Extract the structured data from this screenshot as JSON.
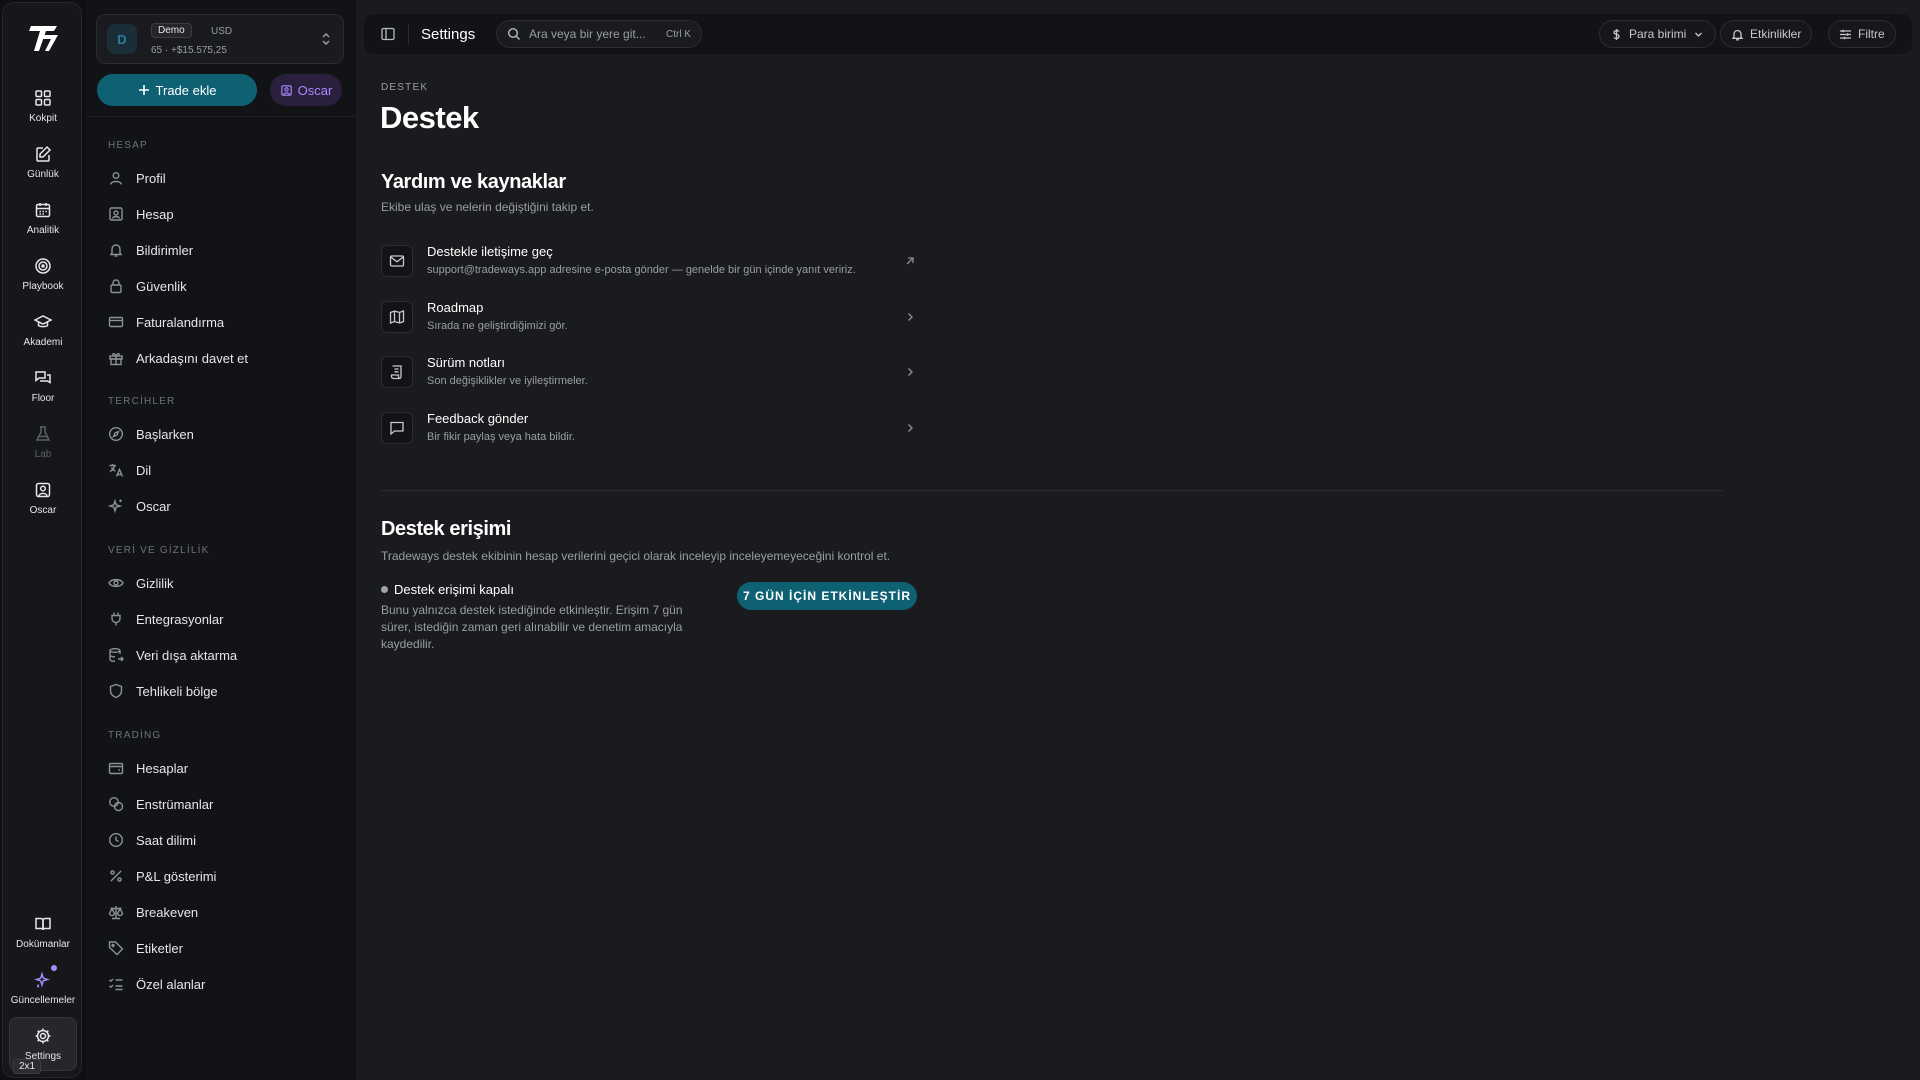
{
  "rail": {
    "items": [
      {
        "label": "Kokpit",
        "icon": "dashboard-icon"
      },
      {
        "label": "Günlük",
        "icon": "journal-icon"
      },
      {
        "label": "Analitik",
        "icon": "calendar-icon"
      },
      {
        "label": "Playbook",
        "icon": "target-icon"
      },
      {
        "label": "Akademi",
        "icon": "graduation-cap-icon"
      },
      {
        "label": "Floor",
        "icon": "chat-bubbles-icon"
      },
      {
        "label": "Lab",
        "icon": "flask-icon"
      },
      {
        "label": "Oscar",
        "icon": "oscar-portrait-icon"
      }
    ],
    "bottom": {
      "docs": "Dokümanlar",
      "updates": "Güncellemeler",
      "settings": "Settings",
      "shortcut_badge": "2x1"
    }
  },
  "account": {
    "initial": "D",
    "tag": "Demo",
    "currency": "USD",
    "balance": "65 · +$15.575,25"
  },
  "actions": {
    "add_trade": "Trade ekle",
    "oscar": "Oscar"
  },
  "sidebar": {
    "sections": [
      {
        "title": "HESAP",
        "items": [
          "Profil",
          "Hesap",
          "Bildirimler",
          "Güvenlik",
          "Faturalandırma",
          "Arkadaşını davet et"
        ]
      },
      {
        "title": "TERCİHLER",
        "items": [
          "Başlarken",
          "Dil",
          "Oscar"
        ]
      },
      {
        "title": "VERİ VE GİZLİLİK",
        "items": [
          "Gizlilik",
          "Entegrasyonlar",
          "Veri dışa aktarma",
          "Tehlikeli bölge"
        ]
      },
      {
        "title": "TRADİNG",
        "items": [
          "Hesaplar",
          "Enstrümanlar",
          "Saat dilimi",
          "P&L gösterimi",
          "Breakeven",
          "Etiketler",
          "Özel alanlar"
        ]
      }
    ]
  },
  "topbar": {
    "title": "Settings",
    "search_placeholder": "Ara veya bir yere git...",
    "search_shortcut": "Ctrl K",
    "currency_btn": "Para birimi",
    "events_btn": "Etkinlikler",
    "filter_btn": "Filtre"
  },
  "page": {
    "eyebrow": "DESTEK",
    "title": "Destek",
    "help": {
      "title": "Yardım ve kaynaklar",
      "subtitle": "Ekibe ulaş ve nelerin değiştiğini takip et.",
      "rows": [
        {
          "title": "Destekle iletişime geç",
          "desc": "support@tradeways.app adresine e-posta gönder — genelde bir gün içinde yanıt veririz."
        },
        {
          "title": "Roadmap",
          "desc": "Sırada ne geliştirdiğimizi gör."
        },
        {
          "title": "Sürüm notları",
          "desc": "Son değişiklikler ve iyileştirmeler."
        },
        {
          "title": "Feedback gönder",
          "desc": "Bir fikir paylaş veya hata bildir."
        }
      ]
    },
    "access": {
      "title": "Destek erişimi",
      "subtitle": "Tradeways destek ekibinin hesap verilerini geçici olarak inceleyip inceleyemeyeceğini kontrol et.",
      "status": "Destek erişimi kapalı",
      "desc": "Bunu yalnızca destek istediğinde etkinleştir. Erişim 7 gün sürer, istediğin zaman geri alınabilir ve denetim amacıyla kaydedilir.",
      "enable_btn": "7 GÜN İÇİN ETKİNLEŞTİR"
    }
  },
  "colors": {
    "accent": "#0e6173",
    "oscar_purple": "#a78bfa",
    "background": "#1a1b1e",
    "sidebar": "#121316"
  }
}
